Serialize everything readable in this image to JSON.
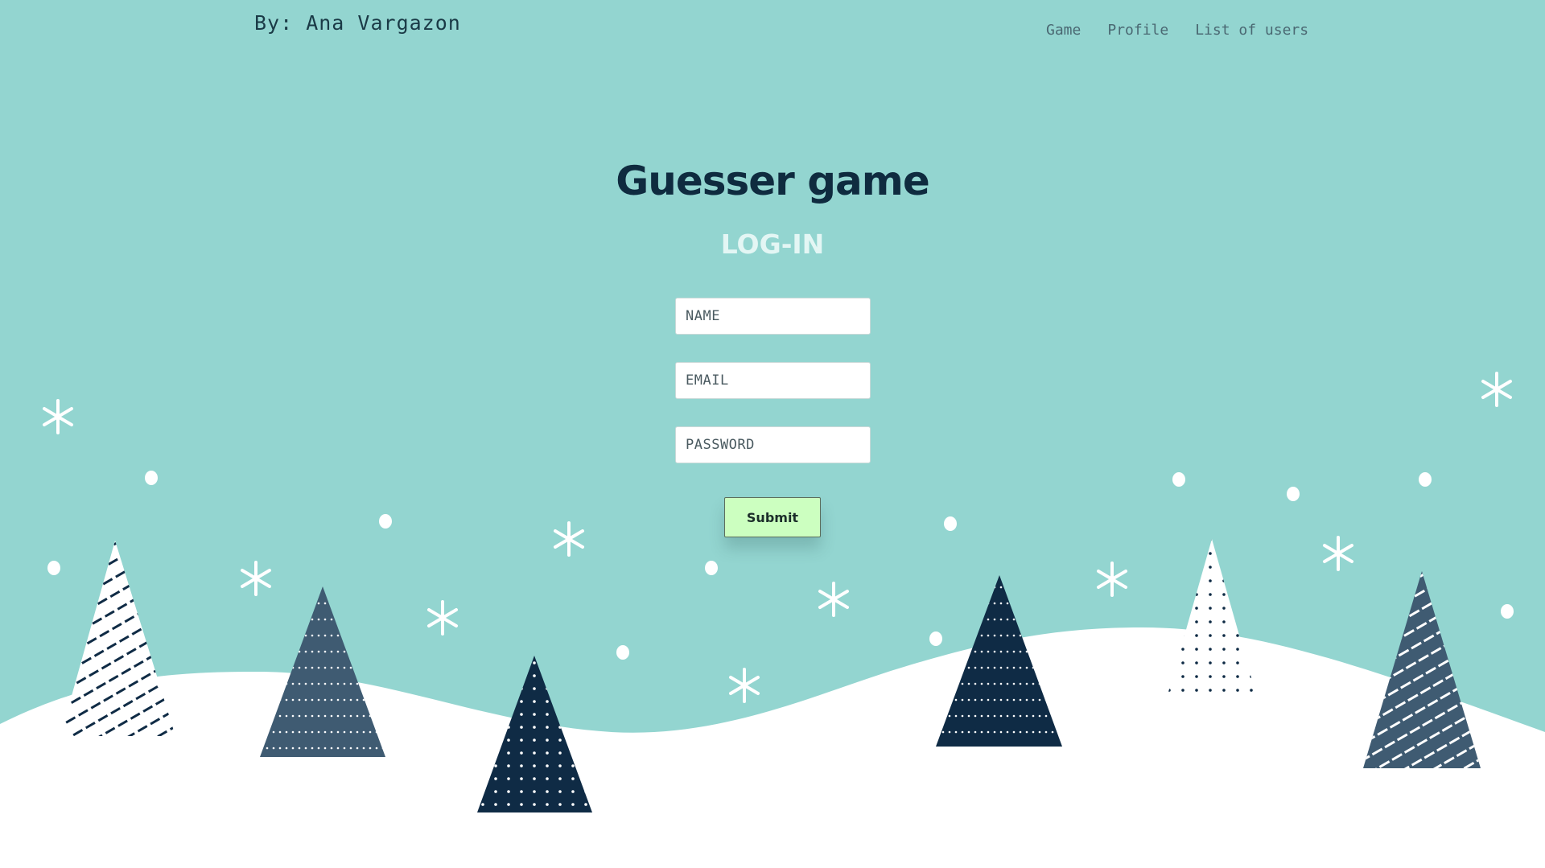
{
  "header": {
    "author": "By: Ana Vargazon",
    "nav": [
      {
        "label": "Game"
      },
      {
        "label": "Profile"
      },
      {
        "label": "List of users"
      }
    ]
  },
  "main": {
    "title": "Guesser game",
    "subtitle": "LOG-IN",
    "form": {
      "name_placeholder": "NAME",
      "email_placeholder": "EMAIL",
      "password_placeholder": "PASSWORD",
      "submit_label": "Submit"
    }
  },
  "colors": {
    "background": "#93d5d0",
    "snow": "#ffffff",
    "tree_dark": "#0f2b45",
    "tree_slate": "#3f5b72",
    "submit_bg": "#ccffc0",
    "title": "#0f2b3f"
  }
}
